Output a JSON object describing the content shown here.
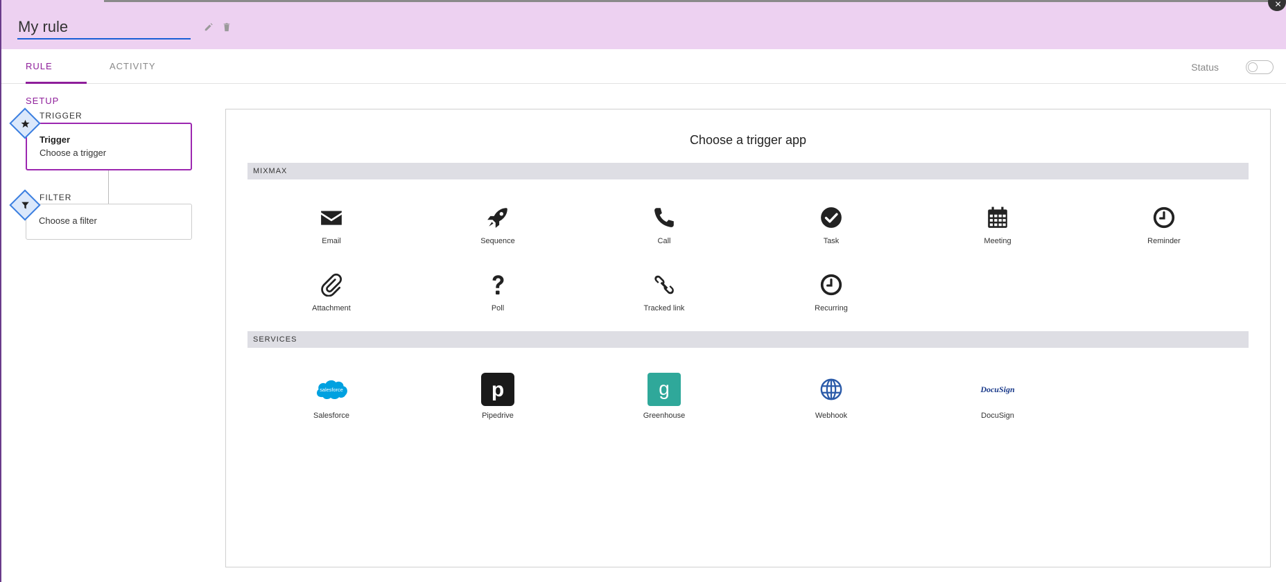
{
  "header": {
    "rule_name": "My rule",
    "edit_icon": "pencil-icon",
    "delete_icon": "trash-icon",
    "close_icon": "close-icon"
  },
  "tabs": [
    {
      "label": "RULE SETUP",
      "active": true
    },
    {
      "label": "ACTIVITY",
      "active": false
    }
  ],
  "status": {
    "label": "Status",
    "enabled": false
  },
  "steps": {
    "trigger": {
      "section_label": "TRIGGER",
      "title": "Trigger",
      "subtitle": "Choose a trigger",
      "icon": "star-icon"
    },
    "filter": {
      "section_label": "FILTER",
      "subtitle": "Choose a filter",
      "icon": "filter-icon"
    }
  },
  "panel": {
    "title": "Choose a trigger app",
    "mixmax": {
      "section_label": "MIXMAX",
      "apps": [
        {
          "label": "Email",
          "icon": "envelope-icon"
        },
        {
          "label": "Sequence",
          "icon": "rocket-icon"
        },
        {
          "label": "Call",
          "icon": "phone-icon"
        },
        {
          "label": "Task",
          "icon": "check-circle-icon"
        },
        {
          "label": "Meeting",
          "icon": "calendar-icon"
        },
        {
          "label": "Reminder",
          "icon": "clock-icon"
        },
        {
          "label": "Attachment",
          "icon": "paperclip-icon"
        },
        {
          "label": "Poll",
          "icon": "question-icon"
        },
        {
          "label": "Tracked link",
          "icon": "link-icon"
        },
        {
          "label": "Recurring",
          "icon": "clock-icon"
        }
      ]
    },
    "services": {
      "section_label": "SERVICES",
      "apps": [
        {
          "label": "Salesforce",
          "icon": "salesforce-logo-icon",
          "logo_text": "salesforce",
          "color": "#00a1e0"
        },
        {
          "label": "Pipedrive",
          "icon": "pipedrive-logo-icon",
          "logo_text": "p",
          "color": "#1a1a1a"
        },
        {
          "label": "Greenhouse",
          "icon": "greenhouse-logo-icon",
          "logo_text": "g",
          "color": "#2fa89a"
        },
        {
          "label": "Webhook",
          "icon": "globe-icon",
          "color": "#2a5aa8"
        },
        {
          "label": "DocuSign",
          "icon": "docusign-logo-icon",
          "logo_text": "DocuSign",
          "color": "#1a3a8a"
        }
      ]
    }
  },
  "colors": {
    "header_bg": "#edd1f1",
    "accent": "#8e1e9a",
    "input_underline": "#1a5fd6",
    "section_bg": "#dedee4",
    "diamond_border": "#3b7fe0"
  }
}
